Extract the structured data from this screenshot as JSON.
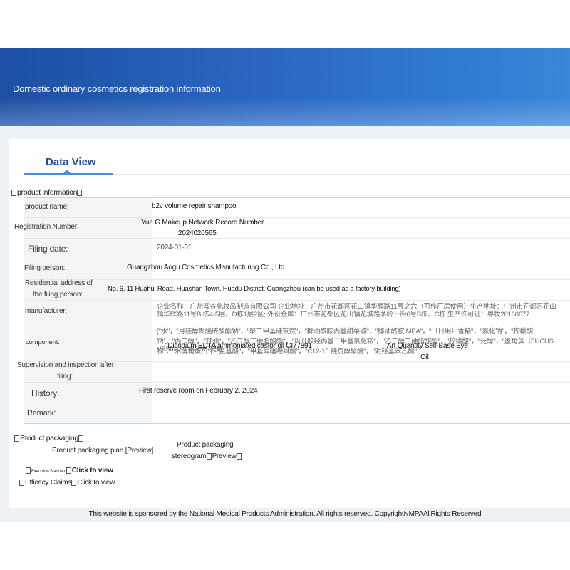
{
  "header": {
    "title": "Domestic ordinary cosmetics registration information"
  },
  "tabs": [
    {
      "label": "Data View"
    }
  ],
  "product_information": {
    "section_title": "product information",
    "rows": {
      "product_name": {
        "label": "product name:",
        "value": "b2v volume repair shampoo"
      },
      "registration_number": {
        "label": "Registration Number:",
        "value_line1": "Yue G Makeup Network Record Number",
        "value_line2": "2024020565"
      },
      "filing_date": {
        "label": "Filing date:",
        "value": "2024-01-31"
      },
      "filing_person": {
        "label": "Filing person:",
        "value": "Guangzhou Aogu Cosmetics Manufacturing Co., Ltd."
      },
      "residential_address": {
        "label_line1": "Residential address of",
        "label_line2": "the filing person:",
        "value": "No. 6, 11 Huahui Road, Huashan Town, Huadu District, Guangzhou (can be used as a factory building)"
      },
      "manufacturer": {
        "label": "manufacturer:",
        "value_line1": "企业名称：广州澳谷化妆品制造有限公司 企业地址：广州市花都区花山镇华辉路11号之六（可作厂房使用）生产地址：广州市花都区花山",
        "value_line2": "镇华辉路11号B 栋4-5层、D栋1层2区; 外设仓库：广州市花都区花山镇花城路茅岭一街6号B栋、C栋 生产许可证：粤妆20160677"
      },
      "component": {
        "label": "component:",
        "chinese_line1": "[\"水\"，\"月桂醇聚醚硫酸酯钠\"，\"聚二甲基硅氧烷\"，\"椰油酰胺丙基甜菜碱\"，\"椰油酰胺 MEA\"，\"（日用）香精\"，\"氯化钠\"，\"柠檬酸",
        "chinese_line2": "钠\"，\"丙二醇\"，\"甘油\"，\"乙二醇二硬脂酸酯\"，\"瓜儿胶羟丙基三甲基氯化铵\"，\"乙二醇二硬脂酸酯\"，\"柠檬酸\"，\"泛醇\"，\"墨角藻（FUCUS VESICULOSUS）提取",
        "chinese_line3": "物\"，\"水解角蛋白\"，\"氨基酸\"，\"甲基异噻唑啉酮\"，\"C12-15 链烷醇聚醚\"，\"对羟基苯乙酮\"",
        "english_a": "\"Disodium EDTA ammoniated castor oil CI77891",
        "english_b": "Art Quantity Self-Base Eye",
        "english_c": "Oil"
      },
      "supervision": {
        "label_line1": "Supervision and inspection after",
        "label_line2": "filing:",
        "value": ""
      },
      "history": {
        "label": "History:",
        "value": "First reserve room on February 2, 2024"
      },
      "remark": {
        "label": "Remark:",
        "value": ""
      }
    }
  },
  "product_packaging": {
    "section_title": "Product packaging",
    "plan_label": "Product packaging plan",
    "plan_preview": "[Preview]",
    "stereogram_line1": "Product packaging",
    "stereogram_line2": "stereogram",
    "stereogram_preview": "Preview",
    "execution_label": "Execution Standard",
    "execution_link": "Click to view",
    "efficacy_label": "Efficacy Claims",
    "efficacy_link": "Click to view"
  },
  "footer": {
    "text": "This website is sponsored by the National Medical Products Administration. All rights reserved. CopyrightNMPAAllRights Reserved"
  },
  "colors": {
    "banner_start": "#1d4fa3",
    "banner_end": "#3a86da",
    "tab_text": "#1f4f97",
    "tab_underline": "#4a8be0"
  }
}
